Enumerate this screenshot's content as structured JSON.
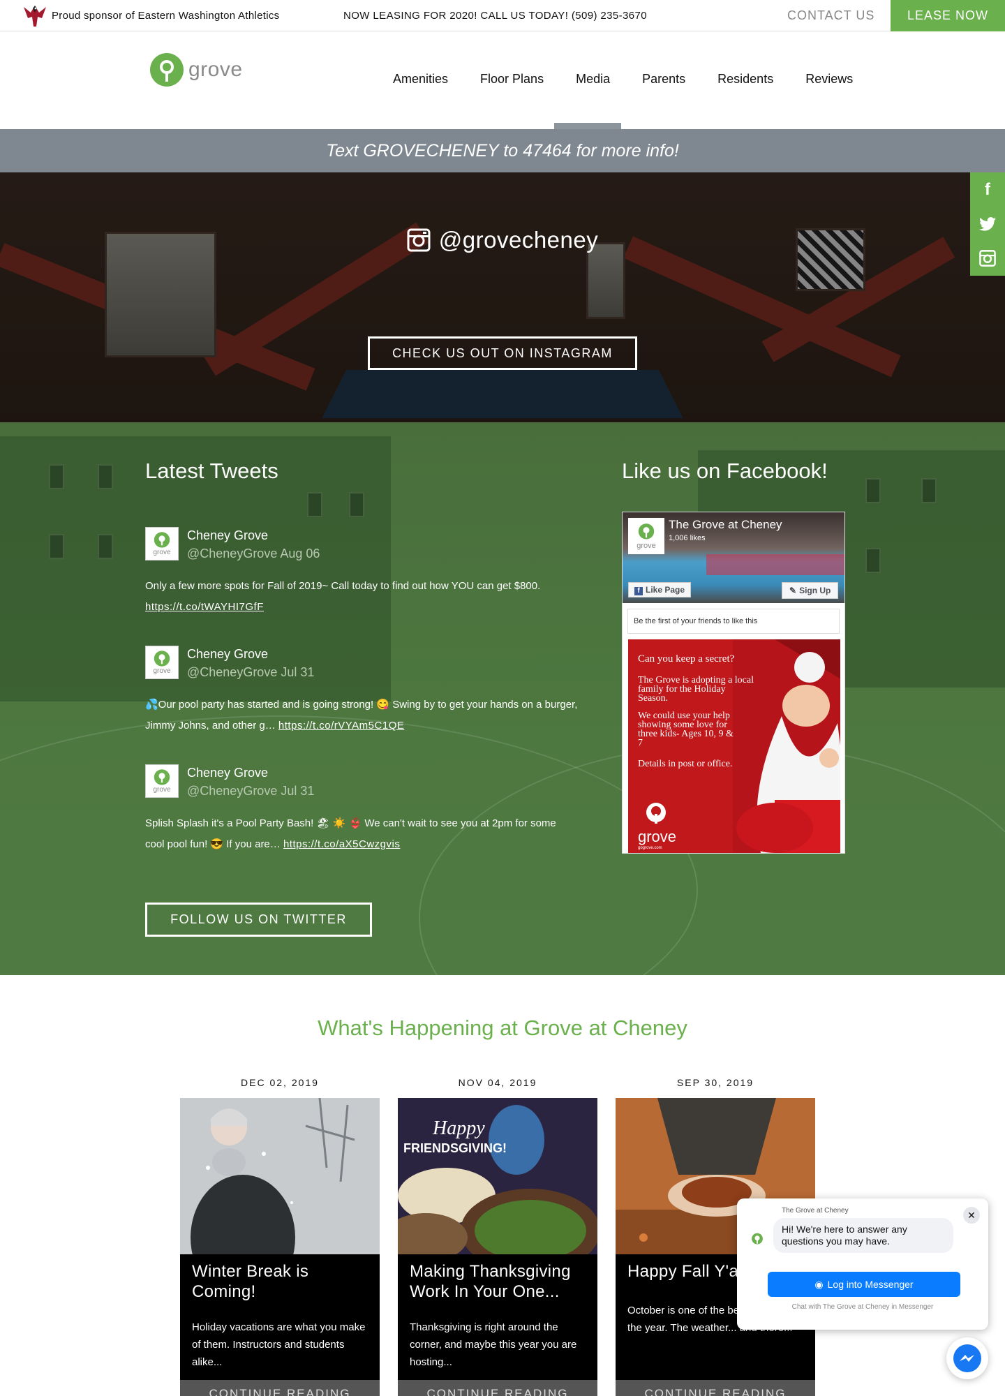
{
  "topbar": {
    "sponsor_text": "Proud sponsor of Eastern Washington Athletics",
    "leasing_text": "NOW LEASING FOR 2020! CALL US TODAY! (509) 235-3670",
    "contact_label": "CONTACT US",
    "lease_label": "LEASE NOW"
  },
  "header": {
    "logo_text": "grove",
    "nav": [
      "Amenities",
      "Floor Plans",
      "Media",
      "Parents",
      "Residents",
      "Reviews"
    ]
  },
  "text_banner": "Text GROVECHENEY to 47464 for more info!",
  "instagram": {
    "handle": "@grovecheney",
    "button_label": "CHECK US OUT ON INSTAGRAM"
  },
  "social_side": {
    "icons": [
      "facebook-icon",
      "twitter-icon",
      "instagram-icon"
    ]
  },
  "tweets": {
    "heading": "Latest Tweets",
    "items": [
      {
        "name": "Cheney Grove",
        "handle": "@CheneyGrove Aug 06",
        "text": "Only a few more spots for Fall of 2019~ Call today to find out how YOU can get $800.",
        "link": "https://t.co/tWAYHI7GfF"
      },
      {
        "name": "Cheney Grove",
        "handle": "@CheneyGrove Jul 31",
        "text": "💦Our pool party has started and is going strong! 😋 Swing by to get your hands on a burger, Jimmy Johns, and other g…",
        "link": "https://t.co/rVYAm5C1QE"
      },
      {
        "name": "Cheney Grove",
        "handle": "@CheneyGrove Jul 31",
        "text": "Splish Splash it's a Pool Party Bash! 🏖 ☀️ 👙 We can't wait to see you at 2pm for some cool pool fun! 😎 If you are…",
        "link": "https://t.co/aX5Cwzgvis"
      }
    ],
    "follow_label": "FOLLOW US ON TWITTER"
  },
  "facebook": {
    "heading": "Like us on Facebook!",
    "page_name": "The Grove at Cheney",
    "likes": "1,006 likes",
    "like_button": "Like Page",
    "signup_button": "Sign Up",
    "friends_text": "Be the first of your friends to like this",
    "post_lines": [
      "Can you keep a secret?",
      "The Grove is adopting a local family for the Holiday Season.",
      "We could use your help showing some love for three kids- Ages 10, 9 & 7",
      "Details in post or office."
    ],
    "post_logo": "grove",
    "post_site": "gogrove.com"
  },
  "news": {
    "heading": "What's Happening at Grove at Cheney",
    "cards": [
      {
        "date": "DEC 02, 2019",
        "title": "Winter Break is Coming!",
        "excerpt": "Holiday vacations are what you make of them. Instructors and students alike...",
        "more": "CONTINUE READING"
      },
      {
        "date": "NOV 04, 2019",
        "title": "Making Thanksgiving Work In Your One...",
        "excerpt": "Thanksgiving is right around the corner, and maybe this year you are hosting...",
        "more": "CONTINUE READING",
        "image_text_1": "Happy",
        "image_text_2": "FRIENDSGIVING!"
      },
      {
        "date": "SEP 30, 2019",
        "title": "Happy Fall Y'all",
        "excerpt": "October is one of the best times of the year. The weather... and there...",
        "more": "CONTINUE READING"
      }
    ]
  },
  "chat": {
    "page_name": "The Grove at Cheney",
    "message": "Hi! We're here to answer any questions you may have.",
    "login_label": "Log into Messenger",
    "note": "Chat with The Grove at Cheney in Messenger",
    "close": "✕"
  },
  "colors": {
    "brand_green": "#6ab04c",
    "banner_gray": "#7f8790",
    "messenger_blue": "#0a7cff"
  }
}
